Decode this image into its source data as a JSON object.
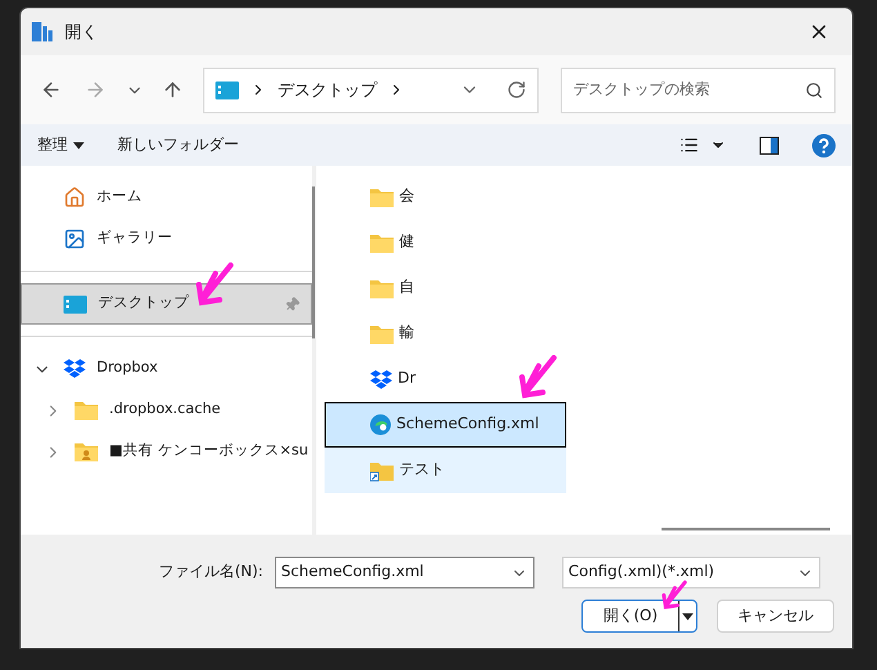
{
  "window": {
    "title": "開く"
  },
  "nav": {
    "breadcrumb": [
      {
        "label": "デスクトップ"
      }
    ],
    "search": {
      "placeholder": "デスクトップの検索"
    }
  },
  "toolbar": {
    "organize": "整理",
    "new_folder": "新しいフォルダー"
  },
  "sidebar": {
    "sections": [
      [
        {
          "kind": "home",
          "label": "ホーム",
          "selected": false
        },
        {
          "kind": "gallery",
          "label": "ギャラリー",
          "selected": false
        }
      ],
      [
        {
          "kind": "desktop",
          "label": "デスクトップ",
          "selected": true,
          "pinned": true
        }
      ],
      [
        {
          "kind": "dropbox",
          "label": "Dropbox",
          "selected": false,
          "expanded": true,
          "children": [
            {
              "kind": "folder",
              "label": ".dropbox.cache",
              "selected": false,
              "expanded": false
            },
            {
              "kind": "shared",
              "label": "■共有 ケンコーボックス×su",
              "selected": false,
              "expanded": false
            }
          ]
        }
      ]
    ]
  },
  "files": [
    {
      "kind": "folder",
      "name": "会",
      "selected": false,
      "hovered": false
    },
    {
      "kind": "folder",
      "name": "健",
      "selected": false,
      "hovered": false
    },
    {
      "kind": "folder",
      "name": "自",
      "selected": false,
      "hovered": false
    },
    {
      "kind": "folder",
      "name": "輸",
      "selected": false,
      "hovered": false
    },
    {
      "kind": "dropbox",
      "name": "Dr",
      "selected": false,
      "hovered": false
    },
    {
      "kind": "edge",
      "name": "SchemeConfig.xml",
      "selected": true,
      "hovered": false
    },
    {
      "kind": "shortcut",
      "name": "テスト",
      "selected": false,
      "hovered": true
    }
  ],
  "bottom": {
    "file_name_label": "ファイル名(N):",
    "file_name": "SchemeConfig.xml",
    "file_type": "Config(.xml)(*.xml)",
    "open_button": "開く(O)",
    "cancel_button": "キャンセル"
  }
}
